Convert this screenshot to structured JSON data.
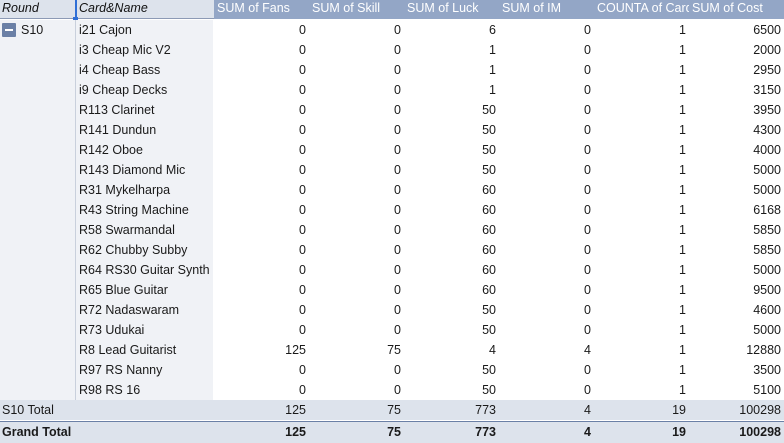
{
  "headers": {
    "round": "Round",
    "card_name": "Card&Name",
    "sum_fans": "SUM of Fans",
    "sum_skill": "SUM of Skill",
    "sum_luck": "SUM of Luck",
    "sum_im": "SUM of IM",
    "counta": "COUNTA of Card",
    "sum_cost": "SUM of Cost"
  },
  "group": {
    "label": "S10",
    "collapse_icon": "minus-icon"
  },
  "rows": [
    {
      "name": "i21 Cajon",
      "fans": "0",
      "skill": "0",
      "luck": "6",
      "im": "0",
      "count": "1",
      "cost": "6500"
    },
    {
      "name": "i3 Cheap Mic V2",
      "fans": "0",
      "skill": "0",
      "luck": "1",
      "im": "0",
      "count": "1",
      "cost": "2000"
    },
    {
      "name": "i4 Cheap Bass",
      "fans": "0",
      "skill": "0",
      "luck": "1",
      "im": "0",
      "count": "1",
      "cost": "2950"
    },
    {
      "name": "i9 Cheap Decks",
      "fans": "0",
      "skill": "0",
      "luck": "1",
      "im": "0",
      "count": "1",
      "cost": "3150"
    },
    {
      "name": "R113 Clarinet",
      "fans": "0",
      "skill": "0",
      "luck": "50",
      "im": "0",
      "count": "1",
      "cost": "3950"
    },
    {
      "name": "R141 Dundun",
      "fans": "0",
      "skill": "0",
      "luck": "50",
      "im": "0",
      "count": "1",
      "cost": "4300"
    },
    {
      "name": "R142 Oboe",
      "fans": "0",
      "skill": "0",
      "luck": "50",
      "im": "0",
      "count": "1",
      "cost": "4000"
    },
    {
      "name": "R143 Diamond Mic",
      "fans": "0",
      "skill": "0",
      "luck": "50",
      "im": "0",
      "count": "1",
      "cost": "5000"
    },
    {
      "name": "R31 Mykelharpa",
      "fans": "0",
      "skill": "0",
      "luck": "60",
      "im": "0",
      "count": "1",
      "cost": "5000"
    },
    {
      "name": "R43 String Machine",
      "fans": "0",
      "skill": "0",
      "luck": "60",
      "im": "0",
      "count": "1",
      "cost": "6168"
    },
    {
      "name": "R58 Swarmandal",
      "fans": "0",
      "skill": "0",
      "luck": "60",
      "im": "0",
      "count": "1",
      "cost": "5850"
    },
    {
      "name": "R62 Chubby Subby",
      "fans": "0",
      "skill": "0",
      "luck": "60",
      "im": "0",
      "count": "1",
      "cost": "5850"
    },
    {
      "name": "R64 RS30 Guitar Synth",
      "fans": "0",
      "skill": "0",
      "luck": "60",
      "im": "0",
      "count": "1",
      "cost": "5000"
    },
    {
      "name": "R65 Blue Guitar",
      "fans": "0",
      "skill": "0",
      "luck": "60",
      "im": "0",
      "count": "1",
      "cost": "9500"
    },
    {
      "name": "R72 Nadaswaram",
      "fans": "0",
      "skill": "0",
      "luck": "50",
      "im": "0",
      "count": "1",
      "cost": "4600"
    },
    {
      "name": "R73 Udukai",
      "fans": "0",
      "skill": "0",
      "luck": "50",
      "im": "0",
      "count": "1",
      "cost": "5000"
    },
    {
      "name": "R8 Lead Guitarist",
      "fans": "125",
      "skill": "75",
      "luck": "4",
      "im": "4",
      "count": "1",
      "cost": "12880"
    },
    {
      "name": "R97 RS Nanny",
      "fans": "0",
      "skill": "0",
      "luck": "50",
      "im": "0",
      "count": "1",
      "cost": "3500"
    },
    {
      "name": "R98 RS 16",
      "fans": "0",
      "skill": "0",
      "luck": "50",
      "im": "0",
      "count": "1",
      "cost": "5100"
    }
  ],
  "subtotal": {
    "label": "S10 Total",
    "fans": "125",
    "skill": "75",
    "luck": "773",
    "im": "4",
    "count": "19",
    "cost": "100298"
  },
  "grand_total": {
    "label": "Grand Total",
    "fans": "125",
    "skill": "75",
    "luck": "773",
    "im": "4",
    "count": "19",
    "cost": "100298"
  },
  "colors": {
    "header_bg": "#93a6c6",
    "row_header_bg": "#f0f2f6",
    "total_bg": "#dde3ec",
    "accent": "#2f6fd6"
  }
}
